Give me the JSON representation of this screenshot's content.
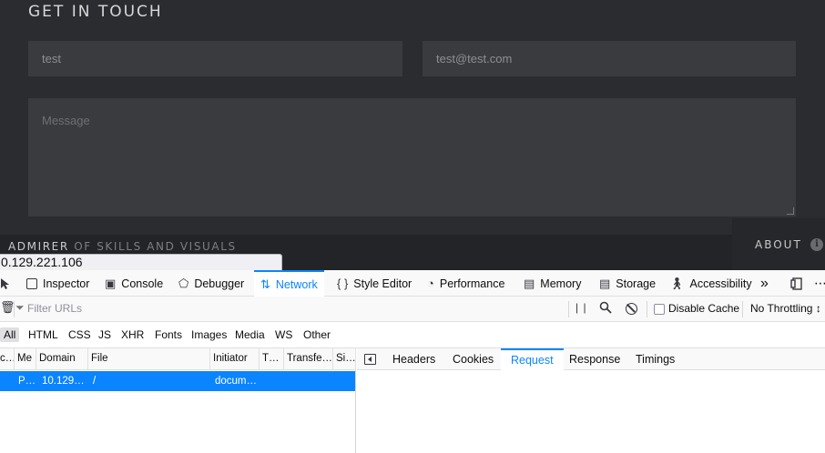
{
  "webpage": {
    "heading": "GET IN TOUCH",
    "name_value": "test",
    "email_value": "test@test.com",
    "message_placeholder": "Message",
    "footer_brand": "ADMIRER",
    "footer_brand_sub": "OF SKILLS AND VISUALS",
    "footer_about": "ABOUT",
    "link_tooltip": "0.129.221.106"
  },
  "devtools": {
    "tabs": [
      "Inspector",
      "Console",
      "Debugger",
      "Network",
      "Style Editor",
      "Performance",
      "Memory",
      "Storage",
      "Accessibility"
    ],
    "active_tab": "Network",
    "filter_placeholder": "Filter URLs",
    "disable_cache_label": "Disable Cache",
    "throttling_label": "No Throttling ↕",
    "type_filters": [
      "All",
      "HTML",
      "CSS",
      "JS",
      "XHR",
      "Fonts",
      "Images",
      "Media",
      "WS",
      "Other"
    ],
    "active_type_filter": "All",
    "columns": [
      "c…",
      "Me",
      "Domain",
      "File",
      "Initiator",
      "T…",
      "Transfe…",
      "Si…"
    ],
    "rows": [
      {
        "status": "",
        "method": "P…",
        "domain": "10.129…",
        "file": "/",
        "initiator": "docum…",
        "type": "",
        "transferred": "",
        "size": ""
      }
    ],
    "detail_tabs": [
      "Headers",
      "Cookies",
      "Request",
      "Response",
      "Timings"
    ],
    "active_detail_tab": "Request"
  },
  "colors": {
    "accent": "#0a84ff",
    "page_bg": "#2b2c2f",
    "field_bg": "#3a3b3f"
  }
}
